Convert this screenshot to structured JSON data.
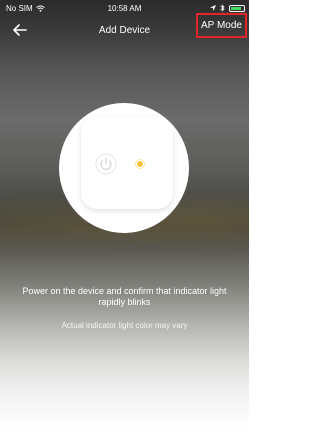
{
  "status_bar": {
    "carrier": "No SIM",
    "time": "10:58 AM"
  },
  "nav": {
    "title": "Add Device",
    "ap_mode_label": "AP Mode"
  },
  "content": {
    "instruction": "Power on the device and confirm that indicator light rapidly blinks",
    "note": "Actual indicator light color may vary"
  },
  "colors": {
    "highlight_border": "#e0262b",
    "battery": "#4cd964",
    "led": "#f5c542"
  },
  "icons": [
    "wifi-icon",
    "location-icon",
    "bluetooth-icon",
    "battery-icon",
    "back-arrow-icon",
    "power-icon",
    "indicator-light-icon"
  ]
}
